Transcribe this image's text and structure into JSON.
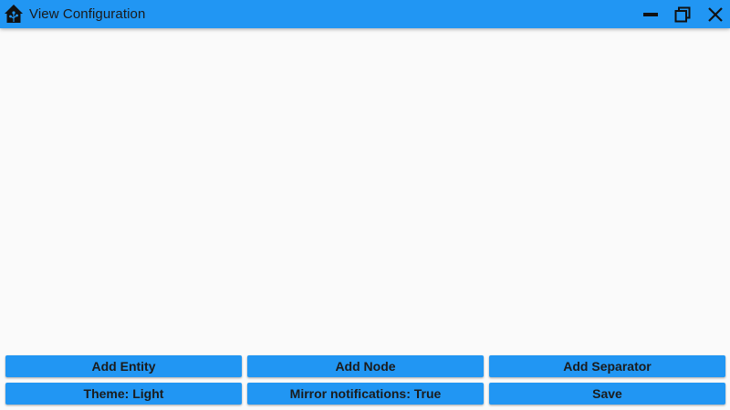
{
  "window": {
    "title": "View Configuration",
    "accent_color": "#2196f3",
    "icons": {
      "app": "home-assistant-icon",
      "minimize": "minimize-icon",
      "maximize": "restore-icon",
      "close": "close-icon"
    }
  },
  "buttons": {
    "row1": [
      "Add Entity",
      "Add Node",
      "Add Separator"
    ],
    "row2": [
      "Theme: Light",
      "Mirror notifications: True",
      "Save"
    ]
  }
}
